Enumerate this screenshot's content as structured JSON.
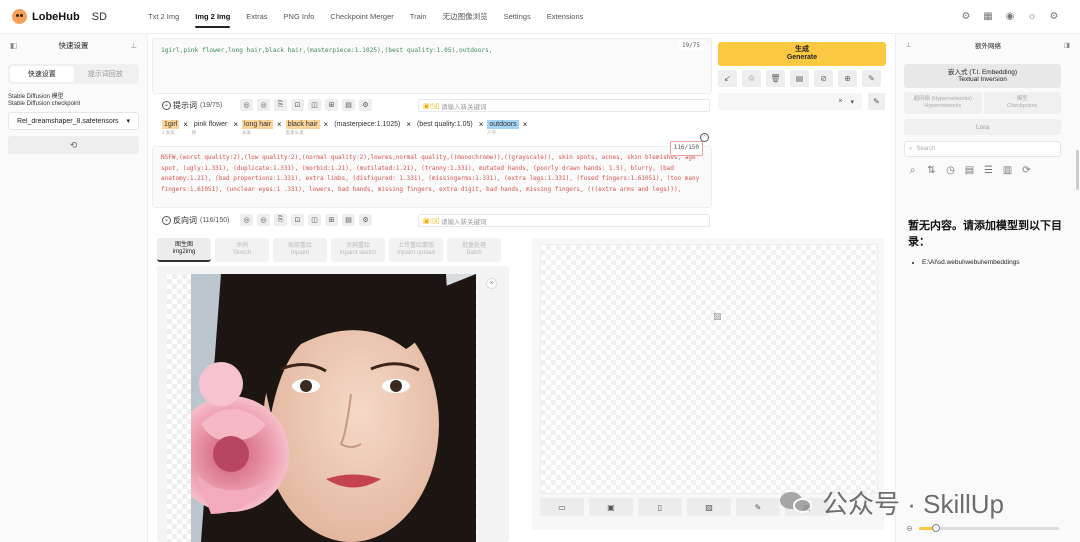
{
  "app": {
    "name": "LobeHub",
    "tag": "SD"
  },
  "nav": {
    "items": [
      "Txt 2 Img",
      "Img 2 Img",
      "Extras",
      "PNG Info",
      "Checkpoint Merger",
      "Train",
      "无边图像浏览",
      "Settings",
      "Extensions"
    ],
    "active_index": 1
  },
  "left_sidebar": {
    "title": "快速设置",
    "tabs": [
      "快速设置",
      "提示词回放"
    ],
    "checkpoint_label_cn": "Stable Diffusion 模型",
    "checkpoint_label": "Stable Diffusion checkpoint",
    "checkpoint_value": "Rel_dreamshaper_8.safetensors"
  },
  "prompt": {
    "text": "1girl,pink flower,long hair,black hair,(masterpiece:1.1025),(best quality:1.05),outdoors,",
    "counter": "19/75",
    "label": "提示词",
    "count": "(19/75)",
    "input_placeholder": "请输入新关键词",
    "tags": [
      {
        "text": "1girl",
        "sub": "1 女孩",
        "color": "orange"
      },
      {
        "text": "pink flower",
        "sub": "粉",
        "color": "none"
      },
      {
        "text": "long hair",
        "sub": "长发",
        "color": "orange"
      },
      {
        "text": "black hair",
        "sub": "黑发头发",
        "color": "orange"
      },
      {
        "text": "(masterpiece:1.1025)",
        "sub": "",
        "color": "none"
      },
      {
        "text": "(best quality:1.05)",
        "sub": "",
        "color": "none"
      },
      {
        "text": "outdoors",
        "sub": "户外",
        "color": "blue"
      }
    ]
  },
  "negative": {
    "text": "NSFW,(worst quality:2),(low quality:2),(normal quality:2),lowres,normal quality,((monochrome)),((grayscale)), skin spots, acnes, skin blemishes, age spot, (ugly:1.331), (duplicate:1.331), (morbid:1.21), (mutilated:1.21), (tranny:1.331), mutated hands, (poorly drawn hands: 1.5), blurry, (bad anatomy:1.21), (bad proportions:1.331), extra limbs, (disfigured: 1.331), (missingarms:1.331), (extra legs:1.331), (fused fingers:1.61051), (too many fingers:1.61051), (unclear eyes:1 .331), lowers, bad hands, missing fingers, extra digit, bad hands, missing fingers, (((extra arms and legs))),",
    "counter": "116/150",
    "label": "反向词",
    "count": "(116/150)",
    "input_placeholder": "请输入新关键词"
  },
  "generate": {
    "cn": "生成",
    "en": "Generate"
  },
  "subtabs": [
    {
      "cn": "图生图",
      "en": "img2img"
    },
    {
      "cn": "涂鸦",
      "en": "Sketch"
    },
    {
      "cn": "局部重绘",
      "en": "Inpaint"
    },
    {
      "cn": "涂鸦重绘",
      "en": "Inpaint sketch"
    },
    {
      "cn": "上传重绘蒙版",
      "en": "Inpaint upload"
    },
    {
      "cn": "批量处理",
      "en": "Batch"
    }
  ],
  "right_sidebar": {
    "title": "额外网络",
    "main_tab": {
      "cn": "嵌入式 (T.I. Embedding)",
      "en": "Textual Inversion"
    },
    "tabs": [
      {
        "cn": "超网络 (Hypernetworks)",
        "en": "Hypernetworks"
      },
      {
        "cn": "模型",
        "en": "Checkpoints"
      }
    ],
    "lora": "Lora",
    "search_placeholder": "Search",
    "empty_message": "暂无内容。请添加模型到以下目录：",
    "empty_path": "E:\\AI\\sd.webui\\webui\\embeddings"
  },
  "watermark": {
    "text": "公众号 · SkillUp"
  },
  "zoom_level": 0.12,
  "colors": {
    "accent": "#fbc842",
    "positive_text": "#3f8c5f",
    "negative_text": "#d9534f",
    "tag_orange": "#fcd39a",
    "tag_blue": "#a5d4f5"
  }
}
